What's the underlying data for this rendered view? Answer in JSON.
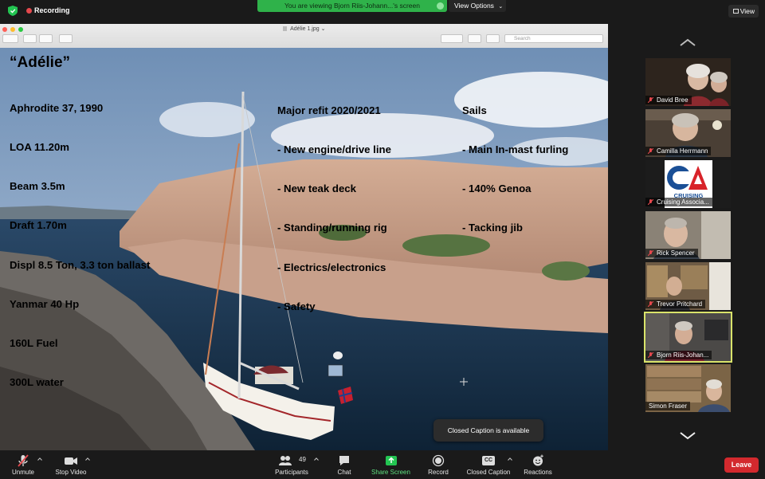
{
  "topbar": {
    "recording_label": "Recording",
    "banner_text": "You are viewing Bjorn Riis-Johann...'s screen",
    "view_options_label": "View Options",
    "view_label": "View"
  },
  "shared_window": {
    "title": "Adélie 1.jpg",
    "search_placeholder": "Search"
  },
  "slide": {
    "title": "“Adélie”",
    "specs": [
      "Aphrodite 37, 1990",
      "LOA 11.20m",
      "Beam 3.5m",
      "Draft 1.70m",
      "Displ 8.5 Ton, 3.3 ton ballast",
      "Yanmar 40 Hp",
      "160L Fuel",
      "300L water"
    ],
    "refit_heading": "Major refit 2020/2021",
    "refit_items": [
      "- New engine/drive line",
      "- New teak deck",
      "- Standing/running rig",
      "- Electrics/electronics",
      "- Safety"
    ],
    "sails_heading": "Sails",
    "sails_items": [
      "- Main In-mast furling",
      "- 140% Genoa",
      "- Tacking jib"
    ]
  },
  "participants": [
    {
      "name": "David Bree",
      "muted": true
    },
    {
      "name": "Camilla Herrmann",
      "muted": true
    },
    {
      "name": "Cruising Associa...",
      "muted": true,
      "logo_text": "CRUISING"
    },
    {
      "name": "Rick Spencer",
      "muted": true
    },
    {
      "name": "Trevor Pritchard",
      "muted": true
    },
    {
      "name": "Bjorn Riis-Johan...",
      "muted": true,
      "active": true
    },
    {
      "name": "Simon Fraser",
      "muted": false
    }
  ],
  "toast": "Closed Caption is available",
  "toolbar": {
    "unmute": "Unmute",
    "stop_video": "Stop Video",
    "participants": "Participants",
    "participants_count": "49",
    "chat": "Chat",
    "share_screen": "Share Screen",
    "record": "Record",
    "closed_caption": "Closed Caption",
    "cc_icon_text": "CC",
    "reactions": "Reactions",
    "leave": "Leave"
  },
  "colors": {
    "banner_green": "#2fb24a",
    "leave_red": "#d3292e",
    "active_speaker": "#d9e36a",
    "share_green": "#23c552"
  }
}
